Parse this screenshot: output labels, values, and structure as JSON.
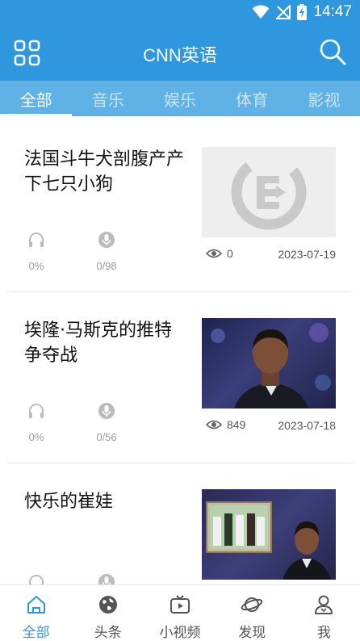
{
  "status_bar": {
    "time": "14:47",
    "icons": [
      "wifi-icon",
      "no-signal-icon",
      "battery-charging-icon"
    ]
  },
  "app_bar": {
    "title": "CNN英语",
    "left_icon": "grid-menu-icon",
    "right_icon": "search-icon"
  },
  "tabs": [
    {
      "label": "全部",
      "active": true
    },
    {
      "label": "音乐",
      "active": false
    },
    {
      "label": "娱乐",
      "active": false
    },
    {
      "label": "体育",
      "active": false
    },
    {
      "label": "影视",
      "active": false
    }
  ],
  "articles": [
    {
      "title": "法国斗牛犬剖腹产产下七只小狗",
      "listen_progress": "0%",
      "record_progress": "0/98",
      "views": "0",
      "date": "2023-07-19",
      "thumbnail": "placeholder-logo"
    },
    {
      "title": "埃隆·马斯克的推特争夺战",
      "listen_progress": "0%",
      "record_progress": "0/56",
      "views": "849",
      "date": "2023-07-18",
      "thumbnail": "host-portrait"
    },
    {
      "title": "快乐的崔娃",
      "listen_progress": "",
      "record_progress": "",
      "views": "",
      "date": "",
      "thumbnail": "host-with-screen"
    }
  ],
  "bottom_nav": [
    {
      "label": "全部",
      "icon": "home-icon",
      "active": true
    },
    {
      "label": "头条",
      "icon": "globe-icon",
      "active": false
    },
    {
      "label": "小视频",
      "icon": "tv-play-icon",
      "active": false
    },
    {
      "label": "发现",
      "icon": "planet-icon",
      "active": false
    },
    {
      "label": "我",
      "icon": "profile-icon",
      "active": false
    }
  ],
  "colors": {
    "primary": "#2e97dd",
    "tab_bar": "#5fb1e6",
    "muted": "#999999"
  }
}
